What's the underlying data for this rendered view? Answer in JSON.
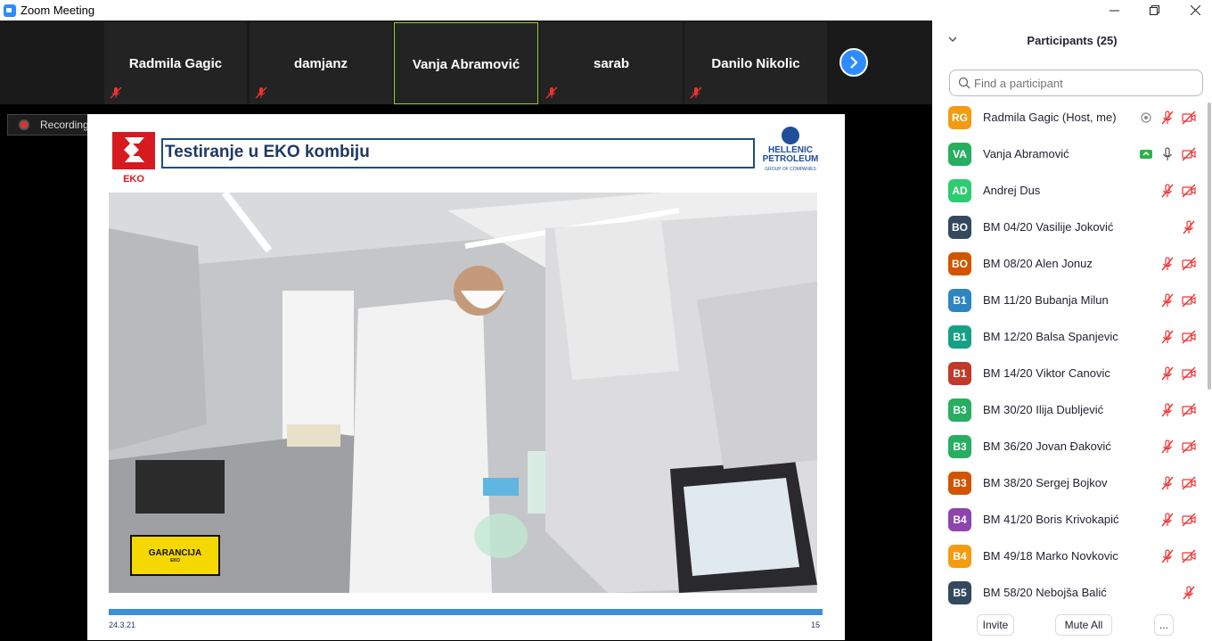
{
  "window": {
    "title": "Zoom Meeting",
    "controls": [
      "minimize-icon",
      "restore-icon",
      "close-icon"
    ]
  },
  "video_strip": {
    "tiles": [
      {
        "name": "Radmila Gagic",
        "muted": true,
        "active": false
      },
      {
        "name": "damjanz",
        "muted": true,
        "active": false
      },
      {
        "name": "Vanja Abramović",
        "muted": false,
        "active": true
      },
      {
        "name": "sarab",
        "muted": true,
        "active": false
      },
      {
        "name": "Danilo Nikolic",
        "muted": true,
        "active": false
      }
    ],
    "next_icon": "chevron-right-icon"
  },
  "recording": {
    "label": "Recording..."
  },
  "slide": {
    "title": "Testiranje u EKO kombiju",
    "logo_left": "EKO",
    "logo_right_line1": "HELLENIC",
    "logo_right_line2": "PETROLEUM",
    "logo_right_line3": "GROUP OF COMPANIES",
    "badge_line1": "GARANCIJA",
    "badge_line2": "EKO",
    "date": "24.3.21",
    "page_number": "15"
  },
  "participants": {
    "header": "Participants (25)",
    "search_placeholder": "Find a participant",
    "items": [
      {
        "initials": "RG",
        "color": "#f39c12",
        "name": "Radmila Gagic (Host, me)",
        "extra": "record",
        "mic": "muted",
        "video": "off"
      },
      {
        "initials": "VA",
        "color": "#27ae60",
        "name": "Vanja Abramović",
        "extra": "share",
        "mic": "on",
        "video": "off"
      },
      {
        "initials": "AD",
        "color": "#2ecc71",
        "name": "Andrej Dus",
        "extra": "",
        "mic": "muted",
        "video": "off"
      },
      {
        "initials": "BO",
        "color": "#34495e",
        "name": "BM 04/20 Vasilije Joković",
        "extra": "",
        "mic": "muted",
        "video": "none"
      },
      {
        "initials": "BO",
        "color": "#d35400",
        "name": "BM 08/20 Alen Jonuz",
        "extra": "",
        "mic": "muted",
        "video": "off"
      },
      {
        "initials": "B1",
        "color": "#2e86c1",
        "name": "BM 11/20 Bubanja Milun",
        "extra": "",
        "mic": "muted",
        "video": "off"
      },
      {
        "initials": "B1",
        "color": "#16a085",
        "name": "BM 12/20 Balsa Spanjevic",
        "extra": "",
        "mic": "muted",
        "video": "off"
      },
      {
        "initials": "B1",
        "color": "#c0392b",
        "name": "BM 14/20 Viktor Canovic",
        "extra": "",
        "mic": "muted",
        "video": "off"
      },
      {
        "initials": "B3",
        "color": "#27ae60",
        "name": "BM 30/20 Ilija Dubljević",
        "extra": "",
        "mic": "muted",
        "video": "off"
      },
      {
        "initials": "B3",
        "color": "#27ae60",
        "name": "BM 36/20 Jovan Đaković",
        "extra": "",
        "mic": "muted",
        "video": "off"
      },
      {
        "initials": "B3",
        "color": "#d35400",
        "name": "BM 38/20 Sergej Bojkov",
        "extra": "",
        "mic": "muted",
        "video": "off"
      },
      {
        "initials": "B4",
        "color": "#8e44ad",
        "name": "BM 41/20 Boris Krivokapić",
        "extra": "",
        "mic": "muted",
        "video": "off"
      },
      {
        "initials": "B4",
        "color": "#f39c12",
        "name": "BM 49/18 Marko Novkovic",
        "extra": "",
        "mic": "muted",
        "video": "off"
      },
      {
        "initials": "B5",
        "color": "#34495e",
        "name": "BM 58/20 Nebojša Balić",
        "extra": "",
        "mic": "muted",
        "video": "none"
      }
    ],
    "footer": {
      "invite": "Invite",
      "mute_all": "Mute All",
      "more": "..."
    }
  }
}
